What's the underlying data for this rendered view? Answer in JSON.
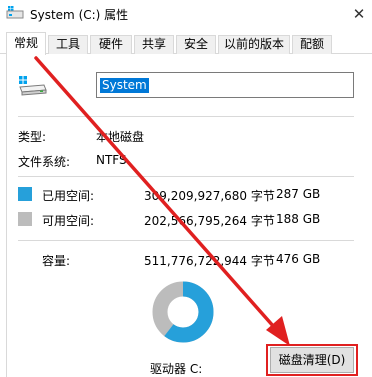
{
  "window": {
    "title": "System (C:) 属性",
    "close_glyph": "✕"
  },
  "tabs": [
    {
      "label": "常规",
      "active": true
    },
    {
      "label": "工具",
      "active": false
    },
    {
      "label": "硬件",
      "active": false
    },
    {
      "label": "共享",
      "active": false
    },
    {
      "label": "安全",
      "active": false
    },
    {
      "label": "以前的版本",
      "active": false
    },
    {
      "label": "配额",
      "active": false
    }
  ],
  "drive": {
    "name_value": "System",
    "icon": "drive-icon"
  },
  "info": {
    "type_label": "类型:",
    "type_value": "本地磁盘",
    "fs_label": "文件系统:",
    "fs_value": "NTFS"
  },
  "space": {
    "used_label": "已用空间:",
    "used_bytes": "309,209,927,680 字节",
    "used_size": "287 GB",
    "free_label": "可用空间:",
    "free_bytes": "202,566,795,264 字节",
    "free_size": "188 GB",
    "capacity_label": "容量:",
    "capacity_bytes": "511,776,722,944 字节",
    "capacity_size": "476 GB",
    "used_color": "#26a0da",
    "free_color": "#bcbcbc",
    "used_fraction": 0.6042
  },
  "footer": {
    "drive_label": "驱动器 C:",
    "cleanup_button": "磁盘清理(D)"
  },
  "annotation": {
    "arrow_color": "#e02020",
    "highlight_color": "#e02020"
  }
}
